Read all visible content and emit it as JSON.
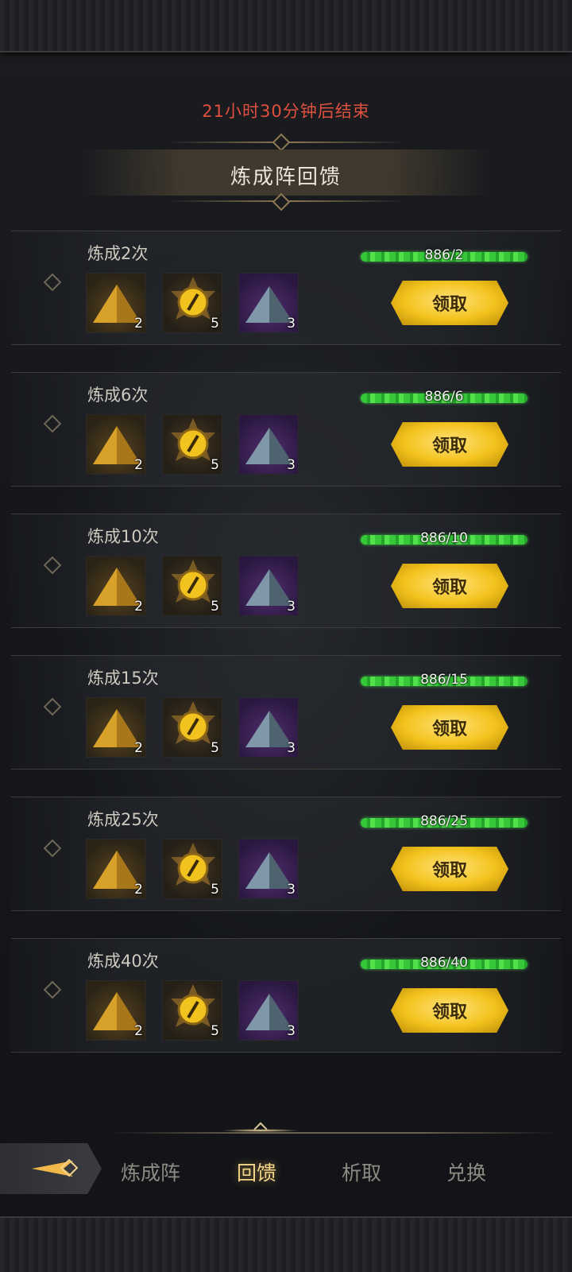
{
  "event": {
    "timer_text": "21小时30分钟后结束",
    "title": "炼成阵回馈"
  },
  "rows": [
    {
      "label": "炼成2次",
      "progress_text": "886/2",
      "progress_fraction": 1.0,
      "claim_label": "领取",
      "items": [
        {
          "icon": "gold-pyramid-icon",
          "count": "2"
        },
        {
          "icon": "golden-eye-medal-icon",
          "count": "5"
        },
        {
          "icon": "blue-crystal-pyramid-icon",
          "count": "3"
        }
      ]
    },
    {
      "label": "炼成6次",
      "progress_text": "886/6",
      "progress_fraction": 1.0,
      "claim_label": "领取",
      "items": [
        {
          "icon": "gold-pyramid-icon",
          "count": "2"
        },
        {
          "icon": "golden-eye-medal-icon",
          "count": "5"
        },
        {
          "icon": "blue-crystal-pyramid-icon",
          "count": "3"
        }
      ]
    },
    {
      "label": "炼成10次",
      "progress_text": "886/10",
      "progress_fraction": 1.0,
      "claim_label": "领取",
      "items": [
        {
          "icon": "gold-pyramid-icon",
          "count": "2"
        },
        {
          "icon": "golden-eye-medal-icon",
          "count": "5"
        },
        {
          "icon": "blue-crystal-pyramid-icon",
          "count": "3"
        }
      ]
    },
    {
      "label": "炼成15次",
      "progress_text": "886/15",
      "progress_fraction": 1.0,
      "claim_label": "领取",
      "items": [
        {
          "icon": "gold-pyramid-icon",
          "count": "2"
        },
        {
          "icon": "golden-eye-medal-icon",
          "count": "5"
        },
        {
          "icon": "blue-crystal-pyramid-icon",
          "count": "3"
        }
      ]
    },
    {
      "label": "炼成25次",
      "progress_text": "886/25",
      "progress_fraction": 1.0,
      "claim_label": "领取",
      "items": [
        {
          "icon": "gold-pyramid-icon",
          "count": "2"
        },
        {
          "icon": "golden-eye-medal-icon",
          "count": "5"
        },
        {
          "icon": "blue-crystal-pyramid-icon",
          "count": "3"
        }
      ]
    },
    {
      "label": "炼成40次",
      "progress_text": "886/40",
      "progress_fraction": 1.0,
      "claim_label": "领取",
      "items": [
        {
          "icon": "gold-pyramid-icon",
          "count": "2"
        },
        {
          "icon": "golden-eye-medal-icon",
          "count": "5"
        },
        {
          "icon": "blue-crystal-pyramid-icon",
          "count": "3"
        }
      ]
    }
  ],
  "tabs": [
    {
      "label": "炼成阵",
      "active": false
    },
    {
      "label": "回馈",
      "active": true
    },
    {
      "label": "析取",
      "active": false
    },
    {
      "label": "兑换",
      "active": false
    }
  ],
  "colors": {
    "timer": "#e0503e",
    "progress": "#37c83a",
    "claim_button": "#f3c21c",
    "active_tab": "#f3d58a"
  }
}
